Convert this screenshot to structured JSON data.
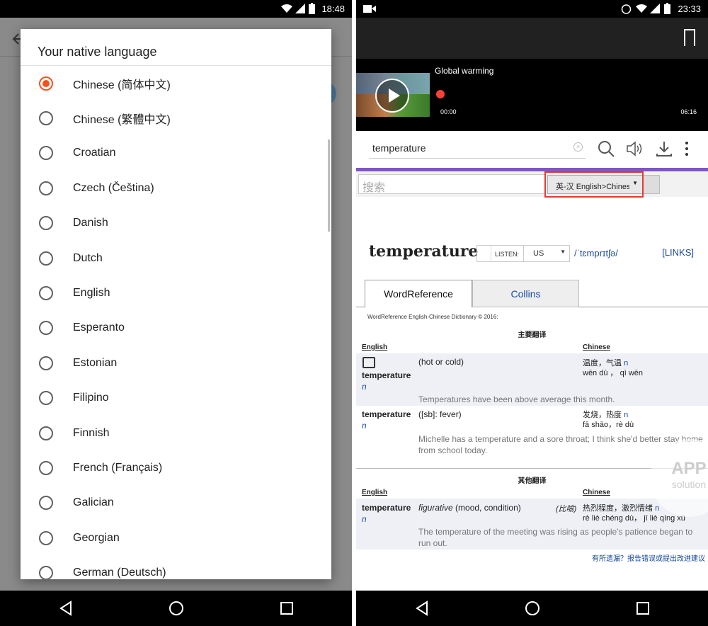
{
  "left_phone": {
    "status_time": "18:48",
    "dialog_title": "Your native language",
    "languages": [
      {
        "label": "Chinese (简体中文)",
        "selected": true
      },
      {
        "label": "Chinese (繁體中文)",
        "selected": false
      },
      {
        "label": "Croatian",
        "selected": false
      },
      {
        "label": "Czech (Čeština)",
        "selected": false
      },
      {
        "label": "Danish",
        "selected": false
      },
      {
        "label": "Dutch",
        "selected": false
      },
      {
        "label": "English",
        "selected": false
      },
      {
        "label": "Esperanto",
        "selected": false
      },
      {
        "label": "Estonian",
        "selected": false
      },
      {
        "label": "Filipino",
        "selected": false
      },
      {
        "label": "Finnish",
        "selected": false
      },
      {
        "label": "French (Français)",
        "selected": false
      },
      {
        "label": "Galician",
        "selected": false
      },
      {
        "label": "Georgian",
        "selected": false
      },
      {
        "label": "German (Deutsch)",
        "selected": false
      }
    ],
    "accent_color": "#f4511e"
  },
  "right_phone": {
    "status_time": "23:33",
    "player": {
      "title": "Global warming",
      "current": "00:00",
      "total": "06:16"
    },
    "search": {
      "query": "temperature"
    },
    "wr": {
      "search_placeholder": "搜索",
      "dictionary": "英-汉 English>Chinese",
      "headword": "temperature",
      "listen_label": "LISTEN:",
      "accent": "US",
      "ipa": "/ˈtɛmprɪtʃə/",
      "links": "[LINKS]",
      "tabs": [
        "WordReference",
        "Collins"
      ],
      "copyright": "WordReference English-Chinese Dictionary © 2016:",
      "section1": "主要翻译",
      "section2": "其他翻译",
      "col_english": "English",
      "col_chinese": "Chinese",
      "entries": [
        {
          "word": "temperature",
          "pos": "n",
          "def": "(hot or cold)",
          "zh": "温度，气温",
          "zh_pos": "n",
          "pinyin": "wēn dù ， qì wēn",
          "example": "Temperatures have been above average this month."
        },
        {
          "word": "temperature",
          "pos": "n",
          "def": "([sb]: fever)",
          "zh": "发烧，热度",
          "zh_pos": "n",
          "pinyin": "fā shāo，rè dù",
          "example": "Michelle has a temperature and a sore throat; I think she'd better stay home from school today."
        },
        {
          "word": "temperature",
          "pos": "n",
          "def_italic": "figurative",
          "def": "(mood, condition)",
          "zh_note": "(比喻)",
          "zh": "热烈程度，激烈情绪",
          "zh_pos": "n",
          "pinyin": "rè liè chéng dù， jī liè qíng xù",
          "example": "The temperature of the meeting was rising as people's patience began to run out."
        }
      ],
      "report": "有所遗漏？报告错误或提出改进建议"
    },
    "watermark": {
      "line1": "APP",
      "line2": "solution"
    }
  }
}
